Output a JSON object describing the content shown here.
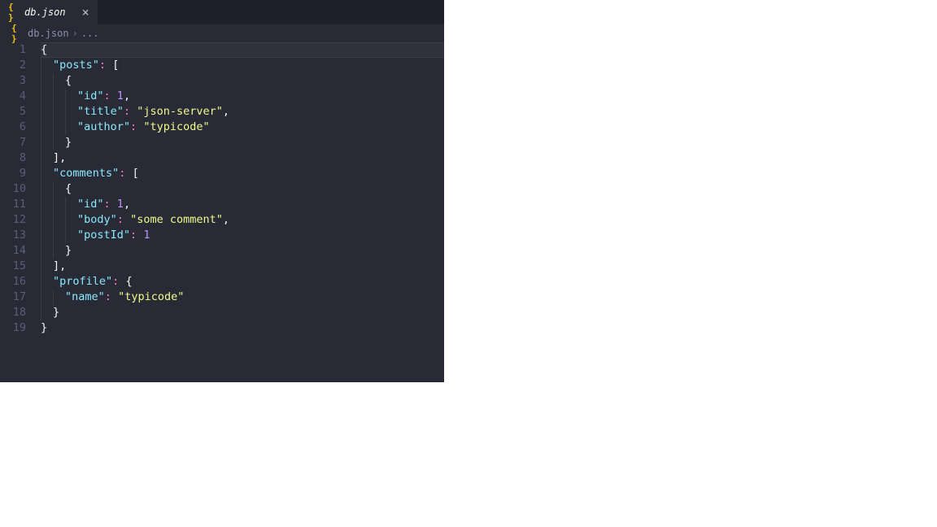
{
  "tab": {
    "filename": "db.json",
    "close_glyph": "×"
  },
  "breadcrumb": {
    "filename": "db.json",
    "chevron": "›",
    "trail": "..."
  },
  "gutter": {
    "lines": [
      "1",
      "2",
      "3",
      "4",
      "5",
      "6",
      "7",
      "8",
      "9",
      "10",
      "11",
      "12",
      "13",
      "14",
      "15",
      "16",
      "17",
      "18",
      "19"
    ]
  },
  "code": {
    "l1": {
      "brace_open": "{"
    },
    "l2": {
      "key": "\"posts\"",
      "colon": ":",
      "brack_open": "["
    },
    "l3": {
      "brace_open": "{"
    },
    "l4": {
      "key": "\"id\"",
      "colon": ":",
      "val": "1",
      "comma": ","
    },
    "l5": {
      "key": "\"title\"",
      "colon": ":",
      "val": "\"json-server\"",
      "comma": ","
    },
    "l6": {
      "key": "\"author\"",
      "colon": ":",
      "val": "\"typicode\""
    },
    "l7": {
      "brace_close": "}"
    },
    "l8": {
      "brack_close": "]",
      "comma": ","
    },
    "l9": {
      "key": "\"comments\"",
      "colon": ":",
      "brack_open": "["
    },
    "l10": {
      "brace_open": "{"
    },
    "l11": {
      "key": "\"id\"",
      "colon": ":",
      "val": "1",
      "comma": ","
    },
    "l12": {
      "key": "\"body\"",
      "colon": ":",
      "val": "\"some comment\"",
      "comma": ","
    },
    "l13": {
      "key": "\"postId\"",
      "colon": ":",
      "val": "1"
    },
    "l14": {
      "brace_close": "}"
    },
    "l15": {
      "brack_close": "]",
      "comma": ","
    },
    "l16": {
      "key": "\"profile\"",
      "colon": ":",
      "brace_open": "{"
    },
    "l17": {
      "key": "\"name\"",
      "colon": ":",
      "val": "\"typicode\""
    },
    "l18": {
      "brace_close": "}"
    },
    "l19": {
      "brace_close": "}"
    }
  }
}
